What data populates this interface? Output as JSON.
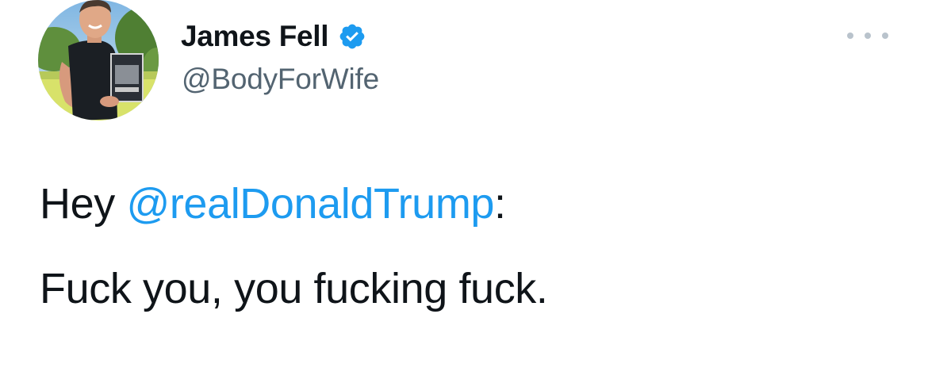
{
  "author": {
    "name": "James Fell",
    "handle": "@BodyForWife",
    "verified": true,
    "verified_icon": "verified-badge-icon",
    "verified_color": "#1d9bf0"
  },
  "actions": {
    "more_icon": "more-options-icon"
  },
  "tweet": {
    "line1_prefix": "Hey ",
    "mention": "@realDonaldTrump",
    "line1_suffix": ":",
    "line2": "Fuck you, you fucking fuck."
  },
  "colors": {
    "text": "#0f1419",
    "secondary_text": "#536471",
    "link": "#1d9bf0"
  }
}
